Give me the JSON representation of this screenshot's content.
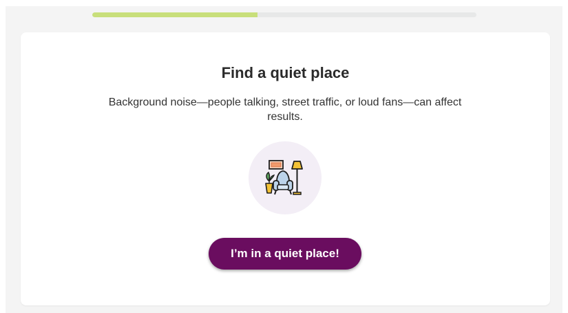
{
  "progress": {
    "fraction": 0.43
  },
  "colors": {
    "progress_fill": "#c8df7b",
    "progress_track": "#e7e8e8",
    "cta_background": "#6a0d5f",
    "illustration_bg": "#f3eef6"
  },
  "card": {
    "title": "Find a quiet place",
    "description": "Background noise—people talking, street traffic, or loud fans—can affect results.",
    "illustration_icon": "quiet-room-armchair-lamp-icon",
    "cta_label": "I’m in a quiet place!"
  }
}
